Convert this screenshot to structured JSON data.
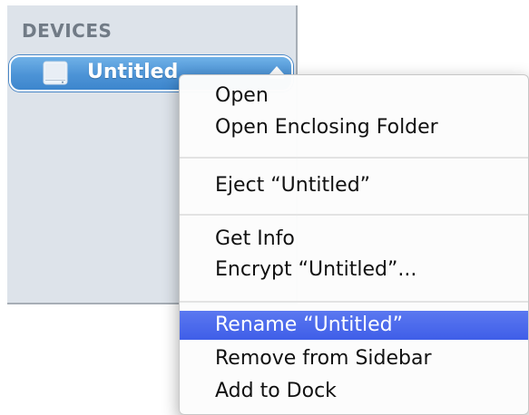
{
  "sidebar": {
    "section_header": "DEVICES",
    "device": {
      "label": "Untitled",
      "icon": "hard-drive-icon",
      "eject_icon": "eject-icon"
    }
  },
  "context_menu": {
    "items": [
      {
        "label": "Open"
      },
      {
        "label": "Open Enclosing Folder"
      },
      {
        "label": "Eject “Untitled”"
      },
      {
        "label": "Get Info"
      },
      {
        "label": "Encrypt “Untitled”..."
      },
      {
        "label": "Rename “Untitled”",
        "highlighted": true
      },
      {
        "label": "Remove from Sidebar"
      },
      {
        "label": "Add to Dock"
      }
    ]
  },
  "colors": {
    "selection_blue": "#4c93d6",
    "menu_highlight": "#3f5ee8",
    "sidebar_bg": "#dde3ea"
  }
}
